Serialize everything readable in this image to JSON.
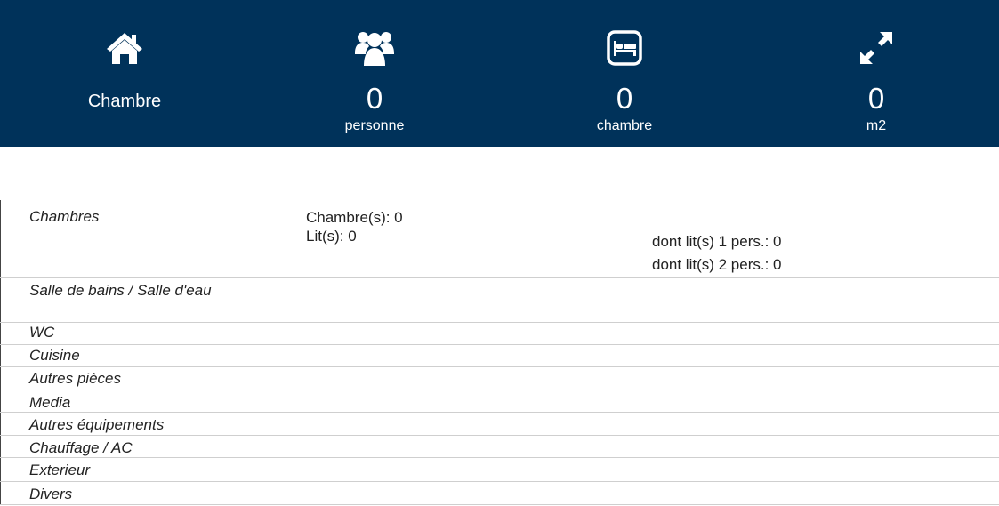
{
  "header": {
    "room_label": "Chambre",
    "stats": [
      {
        "icon": "users-icon",
        "value": "0",
        "unit": "personne"
      },
      {
        "icon": "bed-icon",
        "value": "0",
        "unit": "chambre"
      },
      {
        "icon": "expand-arrows-icon",
        "value": "0",
        "unit": "m2"
      }
    ]
  },
  "details": {
    "chambres": {
      "label": "Chambres",
      "rooms": "Chambre(s): 0",
      "beds": "Lit(s):  0",
      "beds_1p": "dont lit(s) 1 pers.: 0",
      "beds_2p": "dont lit(s) 2 pers.: 0"
    },
    "sections": [
      "Salle de bains / Salle d'eau",
      "WC",
      "Cuisine",
      "Autres pièces",
      "Media",
      "Autres équipements",
      "Chauffage / AC",
      "Exterieur",
      "Divers"
    ]
  },
  "colors": {
    "header_bg": "#00325a",
    "header_text": "#ffffff",
    "separator": "#cfcfcf"
  }
}
